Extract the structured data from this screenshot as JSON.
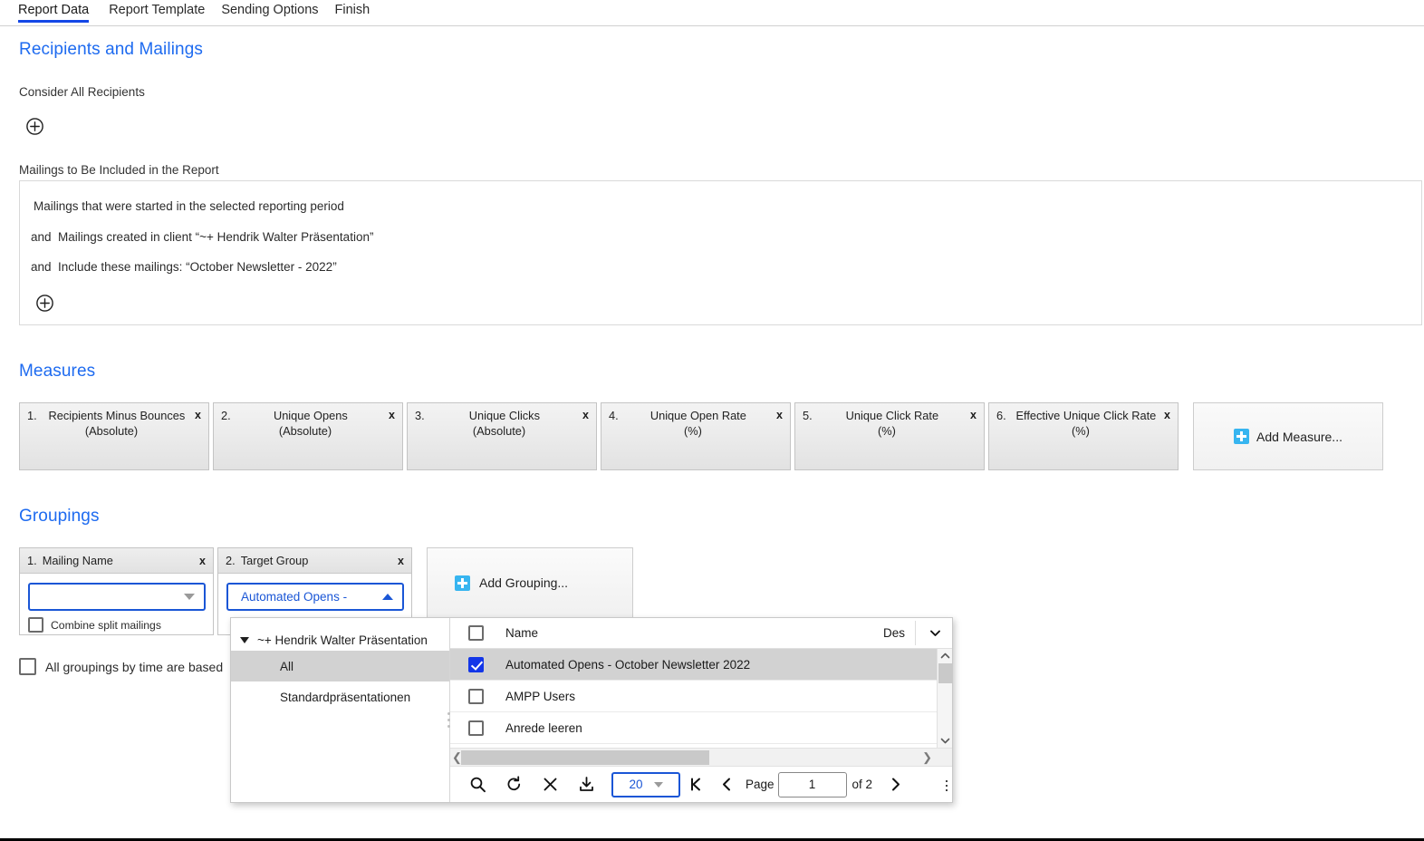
{
  "tabs": [
    {
      "label": "Report Data",
      "active": true
    },
    {
      "label": "Report Template",
      "active": false
    },
    {
      "label": "Sending Options",
      "active": false
    },
    {
      "label": "Finish",
      "active": false
    }
  ],
  "recipients_section": {
    "title": "Recipients and Mailings",
    "consider_label": "Consider All Recipients",
    "add_recipient_icon": "circle-plus-icon",
    "mailings_label": "Mailings to Be Included in the Report",
    "rules": [
      {
        "conjunction": "",
        "text": "Mailings that were started in the selected reporting period"
      },
      {
        "conjunction": "and",
        "text": "Mailings created in client “~+ Hendrik Walter Präsentation”"
      },
      {
        "conjunction": "and",
        "text": "Include these mailings: “October Newsletter - 2022”"
      }
    ],
    "add_rule_icon": "circle-plus-icon"
  },
  "measures_section": {
    "title": "Measures",
    "tiles": [
      {
        "index": "1.",
        "name": "Recipients Minus Bounces",
        "unit": "(Absolute)",
        "remove": "x"
      },
      {
        "index": "2.",
        "name": "Unique Opens",
        "unit": "(Absolute)",
        "remove": "x"
      },
      {
        "index": "3.",
        "name": "Unique Clicks",
        "unit": "(Absolute)",
        "remove": "x"
      },
      {
        "index": "4.",
        "name": "Unique Open Rate",
        "unit": "(%)",
        "remove": "x"
      },
      {
        "index": "5.",
        "name": "Unique Click Rate",
        "unit": "(%)",
        "remove": "x"
      },
      {
        "index": "6.",
        "name": "Effective Unique Click Rate",
        "unit": "(%)",
        "remove": "x"
      }
    ],
    "add_label": "Add Measure..."
  },
  "groupings_section": {
    "title": "Groupings",
    "cards": [
      {
        "index": "1.",
        "title": "Mailing Name",
        "remove": "x",
        "value": "",
        "checkbox_label": "Combine split mailings",
        "checked": false
      },
      {
        "index": "2.",
        "title": "Target Group",
        "remove": "x",
        "value": "Automated Opens -",
        "checked": false
      }
    ],
    "add_label": "Add Grouping...",
    "time_checkbox_label": "All groupings by time are based",
    "time_checked": false
  },
  "dropdown": {
    "tree": {
      "root": "~+ Hendrik Walter Präsentation",
      "items": [
        {
          "label": "All",
          "selected": true
        },
        {
          "label": "Standardpräsentationen",
          "selected": false
        }
      ]
    },
    "grid": {
      "columns": [
        "Name",
        "Des"
      ],
      "header_checkbox_checked": false,
      "rows": [
        {
          "name": "Automated Opens - October Newsletter 2022",
          "checked": true,
          "selected": true
        },
        {
          "name": "AMPP Users",
          "checked": false,
          "selected": false
        },
        {
          "name": "Anrede leeren",
          "checked": false,
          "selected": false
        }
      ]
    },
    "toolbar": {
      "search_icon": "search-icon",
      "refresh_icon": "refresh-icon",
      "clear_icon": "close-icon",
      "download_icon": "download-icon",
      "page_size": "20",
      "first_icon": "first-page-icon",
      "prev_icon": "previous-page-icon",
      "page_label": "Page",
      "page_value": "1",
      "of_label": "of 2",
      "next_icon": "next-page-icon",
      "overflow_icon": "overflow-menu-icon"
    }
  },
  "colors": {
    "accent_blue": "#1e6bf0",
    "tab_underline": "#1447e6",
    "checkbox_blue": "#1336e8",
    "add_icon_blue": "#37b5f0"
  }
}
